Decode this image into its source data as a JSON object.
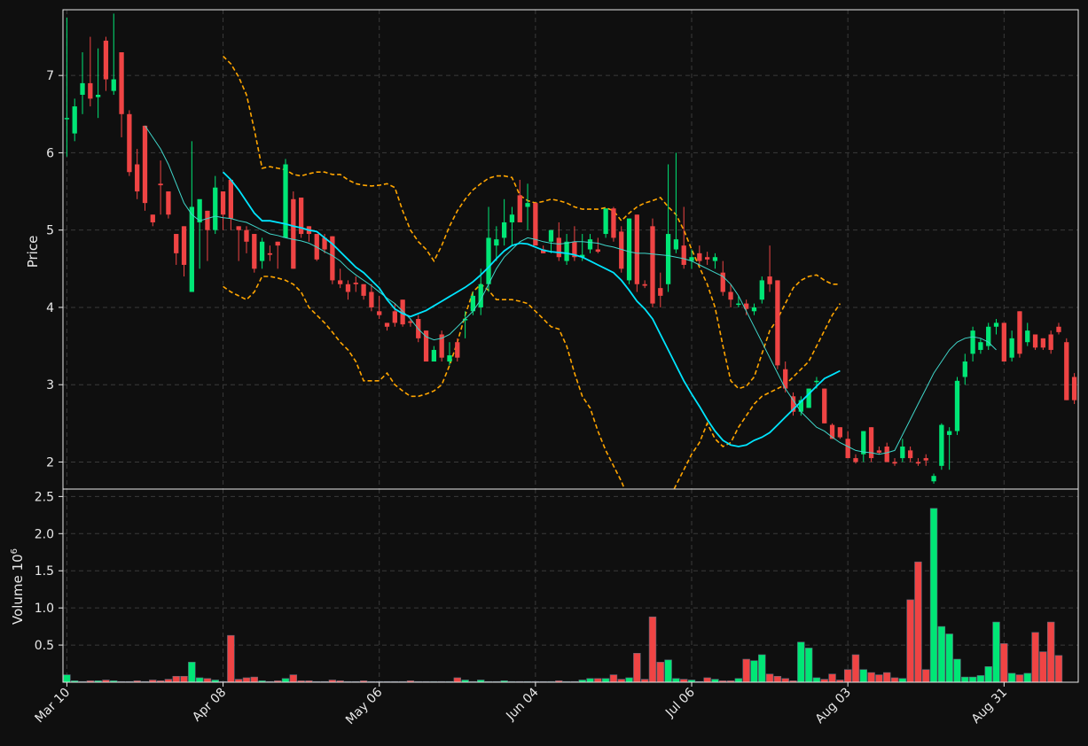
{
  "chart_data": {
    "type": "candlestick",
    "ylabel_price": "Price",
    "ylabel_volume": "Volume",
    "volume_multiplier": "10",
    "volume_exponent": "6",
    "price_ylim": [
      1.65,
      7.85
    ],
    "volume_ylim": [
      0,
      2.6
    ],
    "price_yticks": [
      "2",
      "3",
      "4",
      "5",
      "6",
      "7"
    ],
    "volume_yticks": [
      "0.5",
      "1.0",
      "1.5",
      "2.0",
      "2.5"
    ],
    "date_ticks": [
      {
        "label": "Mar 10",
        "index": 0
      },
      {
        "label": "Apr 08",
        "index": 20
      },
      {
        "label": "May 06",
        "index": 40
      },
      {
        "label": "Jun 04",
        "index": 60
      },
      {
        "label": "Jul 06",
        "index": 80
      },
      {
        "label": "Aug 03",
        "index": 100
      },
      {
        "label": "Aug 31",
        "index": 120
      }
    ],
    "grid": true,
    "colors": {
      "up": "#00e676",
      "down": "#ef4444",
      "ma_fast": "#3fd5c9",
      "ma_slow": "#00e5ff",
      "band": "#ffa500",
      "background": "#0f0f0f"
    },
    "overlays": [
      "moving average (fast)",
      "moving average (slow)",
      "upper band",
      "lower band"
    ],
    "candles": [
      [
        6.45,
        7.75,
        5.95,
        6.45
      ],
      [
        6.25,
        6.7,
        6.15,
        6.6
      ],
      [
        6.75,
        7.3,
        6.5,
        6.9
      ],
      [
        6.9,
        7.5,
        6.6,
        6.7
      ],
      [
        6.72,
        7.35,
        6.45,
        6.75
      ],
      [
        7.45,
        7.5,
        6.8,
        6.95
      ],
      [
        6.8,
        7.8,
        6.75,
        6.95
      ],
      [
        7.3,
        7.3,
        6.2,
        6.5
      ],
      [
        6.5,
        6.55,
        5.7,
        5.75
      ],
      [
        5.85,
        6.05,
        5.4,
        5.5
      ],
      [
        6.35,
        6.35,
        5.25,
        5.35
      ],
      [
        5.2,
        5.2,
        5.05,
        5.1
      ],
      [
        5.6,
        5.9,
        5.2,
        5.58
      ],
      [
        5.5,
        5.5,
        5.15,
        5.2
      ],
      [
        4.95,
        4.95,
        4.55,
        4.7
      ],
      [
        5.05,
        5.05,
        4.4,
        4.55
      ],
      [
        4.2,
        6.15,
        4.2,
        5.3
      ],
      [
        5.1,
        5.35,
        4.5,
        5.4
      ],
      [
        5.25,
        5.25,
        4.6,
        5.0
      ],
      [
        5.0,
        5.7,
        4.95,
        5.55
      ],
      [
        5.5,
        5.5,
        5.0,
        5.2
      ],
      [
        5.65,
        5.65,
        5.0,
        5.15
      ],
      [
        5.05,
        5.05,
        4.6,
        5.0
      ],
      [
        5.0,
        5.05,
        4.7,
        4.85
      ],
      [
        4.95,
        4.95,
        4.45,
        4.5
      ],
      [
        4.6,
        4.9,
        4.5,
        4.85
      ],
      [
        4.7,
        4.8,
        4.6,
        4.68
      ],
      [
        4.85,
        4.85,
        4.5,
        4.8
      ],
      [
        4.9,
        5.92,
        4.9,
        5.85
      ],
      [
        5.4,
        5.5,
        4.5,
        4.5
      ],
      [
        5.42,
        5.42,
        4.9,
        4.95
      ],
      [
        5.05,
        5.05,
        4.85,
        4.95
      ],
      [
        4.95,
        4.95,
        4.6,
        4.62
      ],
      [
        4.9,
        4.95,
        4.7,
        4.75
      ],
      [
        4.92,
        4.92,
        4.3,
        4.35
      ],
      [
        4.35,
        4.5,
        4.25,
        4.3
      ],
      [
        4.3,
        4.35,
        4.1,
        4.2
      ],
      [
        4.32,
        4.4,
        4.2,
        4.3
      ],
      [
        4.3,
        4.3,
        4.1,
        4.15
      ],
      [
        4.2,
        4.3,
        3.95,
        4.0
      ],
      [
        3.95,
        4.15,
        3.85,
        3.9
      ],
      [
        3.8,
        3.8,
        3.7,
        3.75
      ],
      [
        3.95,
        4.05,
        3.75,
        3.8
      ],
      [
        4.1,
        4.1,
        3.75,
        3.78
      ],
      [
        3.82,
        3.85,
        3.75,
        3.8
      ],
      [
        3.85,
        3.9,
        3.55,
        3.6
      ],
      [
        3.7,
        3.7,
        3.3,
        3.3
      ],
      [
        3.3,
        3.5,
        3.3,
        3.45
      ],
      [
        3.65,
        3.7,
        3.3,
        3.35
      ],
      [
        3.3,
        3.55,
        3.25,
        3.38
      ],
      [
        3.55,
        3.6,
        3.3,
        3.35
      ],
      [
        3.85,
        3.95,
        3.6,
        3.85
      ],
      [
        3.95,
        4.2,
        3.9,
        4.15
      ],
      [
        4.0,
        4.5,
        3.9,
        4.3
      ],
      [
        4.3,
        5.3,
        4.2,
        4.9
      ],
      [
        4.8,
        5.05,
        4.6,
        4.88
      ],
      [
        4.9,
        5.4,
        4.8,
        5.1
      ],
      [
        5.1,
        5.3,
        4.8,
        5.2
      ],
      [
        5.45,
        5.65,
        5.4,
        5.1
      ],
      [
        5.3,
        5.6,
        5.0,
        5.35
      ],
      [
        5.35,
        5.35,
        4.85,
        4.8
      ],
      [
        4.75,
        4.8,
        4.7,
        4.7
      ],
      [
        4.85,
        5.0,
        4.7,
        5.0
      ],
      [
        4.9,
        5.1,
        4.6,
        4.65
      ],
      [
        4.6,
        4.95,
        4.55,
        4.85
      ],
      [
        4.85,
        5.05,
        4.6,
        4.65
      ],
      [
        4.65,
        4.95,
        4.6,
        4.68
      ],
      [
        4.75,
        4.95,
        4.7,
        4.88
      ],
      [
        4.75,
        4.9,
        4.7,
        4.72
      ],
      [
        4.95,
        5.2,
        4.9,
        5.28
      ],
      [
        5.28,
        5.3,
        4.85,
        4.9
      ],
      [
        4.98,
        5.05,
        4.45,
        4.5
      ],
      [
        4.35,
        5.15,
        4.3,
        5.15
      ],
      [
        5.2,
        5.2,
        4.2,
        4.3
      ],
      [
        4.3,
        4.35,
        4.25,
        4.28
      ],
      [
        5.05,
        5.15,
        4.0,
        4.05
      ],
      [
        4.25,
        4.45,
        4.0,
        4.15
      ],
      [
        4.3,
        5.85,
        4.2,
        4.95
      ],
      [
        4.75,
        6.0,
        4.7,
        4.88
      ],
      [
        4.8,
        5.3,
        4.5,
        4.55
      ],
      [
        4.6,
        4.75,
        4.5,
        4.65
      ],
      [
        4.7,
        4.8,
        4.55,
        4.6
      ],
      [
        4.65,
        4.72,
        4.55,
        4.62
      ],
      [
        4.6,
        4.7,
        4.5,
        4.65
      ],
      [
        4.45,
        4.6,
        4.15,
        4.2
      ],
      [
        4.2,
        4.3,
        4.0,
        4.1
      ],
      [
        4.05,
        4.15,
        4.0,
        4.05
      ],
      [
        4.05,
        4.1,
        3.9,
        3.98
      ],
      [
        3.95,
        4.05,
        3.9,
        4.0
      ],
      [
        4.1,
        4.4,
        4.05,
        4.35
      ],
      [
        4.4,
        4.8,
        4.2,
        4.3
      ],
      [
        4.35,
        4.35,
        3.2,
        3.25
      ],
      [
        3.2,
        3.3,
        2.9,
        2.95
      ],
      [
        2.85,
        2.9,
        2.6,
        2.65
      ],
      [
        2.65,
        2.85,
        2.6,
        2.8
      ],
      [
        2.7,
        2.95,
        2.7,
        2.95
      ],
      [
        3.05,
        3.1,
        2.95,
        3.05
      ],
      [
        2.95,
        2.95,
        2.5,
        2.5
      ],
      [
        2.48,
        2.5,
        2.3,
        2.3
      ],
      [
        2.45,
        2.45,
        2.3,
        2.32
      ],
      [
        2.3,
        2.4,
        2.05,
        2.05
      ],
      [
        2.05,
        2.1,
        1.98,
        2.0
      ],
      [
        2.1,
        2.4,
        2.0,
        2.4
      ],
      [
        2.45,
        2.45,
        2.0,
        2.05
      ],
      [
        2.15,
        2.2,
        2.1,
        2.12
      ],
      [
        2.2,
        2.25,
        2.0,
        2.0
      ],
      [
        2.0,
        2.05,
        1.95,
        1.98
      ],
      [
        2.05,
        2.3,
        2.0,
        2.2
      ],
      [
        2.15,
        2.2,
        2.0,
        2.05
      ],
      [
        2.0,
        2.05,
        1.95,
        1.98
      ],
      [
        2.05,
        2.1,
        1.95,
        2.02
      ],
      [
        1.75,
        1.85,
        1.72,
        1.82
      ],
      [
        1.95,
        2.5,
        1.9,
        2.48
      ],
      [
        2.35,
        2.45,
        1.9,
        2.4
      ],
      [
        2.4,
        3.1,
        2.35,
        3.05
      ],
      [
        3.1,
        3.4,
        3.0,
        3.3
      ],
      [
        3.4,
        3.75,
        3.3,
        3.7
      ],
      [
        3.45,
        3.6,
        3.4,
        3.55
      ],
      [
        3.5,
        3.8,
        3.45,
        3.75
      ],
      [
        3.75,
        3.85,
        3.65,
        3.8
      ],
      [
        3.8,
        3.8,
        3.3,
        3.3
      ],
      [
        3.35,
        3.7,
        3.3,
        3.6
      ],
      [
        3.95,
        3.95,
        3.35,
        3.4
      ],
      [
        3.55,
        3.8,
        3.5,
        3.7
      ],
      [
        3.65,
        3.65,
        3.45,
        3.48
      ],
      [
        3.6,
        3.6,
        3.45,
        3.48
      ],
      [
        3.65,
        3.7,
        3.4,
        3.45
      ],
      [
        3.75,
        3.8,
        3.65,
        3.68
      ],
      [
        3.55,
        3.6,
        2.8,
        2.8
      ],
      [
        3.1,
        3.15,
        2.75,
        2.8
      ]
    ],
    "volume": [
      0.1,
      0.02,
      0.01,
      0.02,
      0.02,
      0.03,
      0.02,
      0.01,
      0.01,
      0.02,
      0.01,
      0.03,
      0.02,
      0.04,
      0.08,
      0.08,
      0.27,
      0.06,
      0.05,
      0.03,
      0.01,
      0.63,
      0.04,
      0.06,
      0.07,
      0.02,
      0.01,
      0.02,
      0.05,
      0.1,
      0.02,
      0.02,
      0.01,
      0.01,
      0.03,
      0.02,
      0.01,
      0.01,
      0.02,
      0.01,
      0.01,
      0.01,
      0.01,
      0.01,
      0.02,
      0.01,
      0.01,
      0.01,
      0.01,
      0.01,
      0.06,
      0.03,
      0.01,
      0.03,
      0.01,
      0.01,
      0.02,
      0.01,
      0.01,
      0.01,
      0.01,
      0.01,
      0.01,
      0.02,
      0.01,
      0.01,
      0.03,
      0.05,
      0.05,
      0.05,
      0.1,
      0.04,
      0.06,
      0.39,
      0.04,
      0.88,
      0.27,
      0.3,
      0.05,
      0.04,
      0.03,
      0.01,
      0.06,
      0.04,
      0.02,
      0.02,
      0.05,
      0.31,
      0.29,
      0.37,
      0.11,
      0.08,
      0.05,
      0.02,
      0.54,
      0.46,
      0.06,
      0.04,
      0.11,
      0.03,
      0.17,
      0.37,
      0.17,
      0.13,
      0.1,
      0.13,
      0.06,
      0.05,
      1.11,
      1.62,
      0.17,
      2.34,
      0.75,
      0.65,
      0.31,
      0.07,
      0.07,
      0.09,
      0.21,
      0.81,
      0.52,
      0.12,
      0.1,
      0.12,
      0.67,
      0.41,
      0.81,
      0.36
    ],
    "ma_fast": [
      null,
      null,
      null,
      null,
      null,
      null,
      null,
      null,
      null,
      null,
      6.35,
      6.2,
      6.05,
      5.85,
      5.6,
      5.35,
      5.2,
      5.12,
      5.15,
      5.18,
      5.16,
      5.15,
      5.12,
      5.1,
      5.05,
      5.0,
      4.95,
      4.93,
      4.9,
      4.88,
      4.86,
      4.83,
      4.78,
      4.72,
      4.67,
      4.6,
      4.5,
      4.42,
      4.35,
      4.28,
      4.2,
      4.12,
      4.05,
      3.95,
      3.85,
      3.72,
      3.62,
      3.58,
      3.6,
      3.65,
      3.75,
      3.85,
      3.95,
      4.1,
      4.3,
      4.5,
      4.65,
      4.75,
      4.85,
      4.9,
      4.88,
      4.85,
      4.83,
      4.82,
      4.83,
      4.85,
      4.85,
      4.84,
      4.83,
      4.8,
      4.78,
      4.75,
      4.72,
      4.7,
      4.7,
      4.69,
      4.68,
      4.67,
      4.65,
      4.63,
      4.6,
      4.55,
      4.5,
      4.45,
      4.4,
      4.3,
      4.15,
      3.95,
      3.75,
      3.55,
      3.35,
      3.15,
      2.95,
      2.8,
      2.65,
      2.55,
      2.45,
      2.4,
      2.32,
      2.25,
      2.2,
      2.15,
      2.13,
      2.12,
      2.1,
      2.12,
      2.15,
      2.35,
      2.55,
      2.75,
      2.95,
      3.15,
      3.3,
      3.45,
      3.55,
      3.6,
      3.62,
      3.6,
      3.55,
      3.45
    ],
    "ma_slow": [
      null,
      null,
      null,
      null,
      null,
      null,
      null,
      null,
      null,
      null,
      null,
      null,
      null,
      null,
      null,
      null,
      null,
      null,
      null,
      null,
      5.75,
      5.65,
      5.52,
      5.37,
      5.22,
      5.12,
      5.12,
      5.1,
      5.08,
      5.05,
      5.03,
      5.0,
      4.98,
      4.9,
      4.82,
      4.72,
      4.62,
      4.52,
      4.45,
      4.35,
      4.25,
      4.1,
      3.98,
      3.92,
      3.88,
      3.92,
      3.96,
      4.02,
      4.08,
      4.14,
      4.2,
      4.26,
      4.33,
      4.42,
      4.52,
      4.63,
      4.73,
      4.8,
      4.83,
      4.82,
      4.78,
      4.74,
      4.72,
      4.71,
      4.7,
      4.68,
      4.65,
      4.6,
      4.55,
      4.5,
      4.45,
      4.35,
      4.22,
      4.08,
      3.98,
      3.85,
      3.65,
      3.45,
      3.25,
      3.05,
      2.88,
      2.72,
      2.55,
      2.4,
      2.28,
      2.22,
      2.2,
      2.22,
      2.28,
      2.32,
      2.38,
      2.48,
      2.58,
      2.68,
      2.78,
      2.88,
      2.98,
      3.08,
      3.13,
      3.18
    ],
    "band_upper": [
      null,
      null,
      null,
      null,
      null,
      null,
      null,
      null,
      null,
      null,
      null,
      null,
      null,
      null,
      null,
      null,
      null,
      null,
      null,
      null,
      7.25,
      7.15,
      6.98,
      6.75,
      6.3,
      5.8,
      5.82,
      5.8,
      5.78,
      5.72,
      5.7,
      5.73,
      5.75,
      5.75,
      5.72,
      5.72,
      5.65,
      5.6,
      5.58,
      5.57,
      5.58,
      5.6,
      5.55,
      5.25,
      5.0,
      4.85,
      4.75,
      4.6,
      4.8,
      5.05,
      5.25,
      5.4,
      5.52,
      5.6,
      5.67,
      5.7,
      5.7,
      5.68,
      5.45,
      5.38,
      5.35,
      5.37,
      5.4,
      5.38,
      5.35,
      5.3,
      5.27,
      5.27,
      5.27,
      5.29,
      5.25,
      5.12,
      5.22,
      5.3,
      5.35,
      5.38,
      5.42,
      5.3,
      5.2,
      5.0,
      4.75,
      4.52,
      4.3,
      4.0,
      3.5,
      3.05,
      2.95,
      2.98,
      3.1,
      3.4,
      3.7,
      3.85,
      4.05,
      4.25,
      4.35,
      4.4,
      4.42,
      4.35,
      4.3,
      4.3
    ],
    "band_lower": [
      null,
      null,
      null,
      null,
      null,
      null,
      null,
      null,
      null,
      null,
      null,
      null,
      null,
      null,
      null,
      null,
      null,
      null,
      null,
      null,
      4.27,
      4.2,
      4.15,
      4.1,
      4.2,
      4.4,
      4.4,
      4.38,
      4.35,
      4.3,
      4.2,
      4.0,
      3.9,
      3.8,
      3.68,
      3.55,
      3.45,
      3.3,
      3.05,
      3.05,
      3.05,
      3.15,
      3.0,
      2.92,
      2.85,
      2.85,
      2.88,
      2.92,
      3.0,
      3.25,
      3.55,
      3.9,
      4.2,
      4.3,
      4.22,
      4.1,
      4.1,
      4.1,
      4.08,
      4.05,
      3.95,
      3.85,
      3.75,
      3.72,
      3.5,
      3.15,
      2.85,
      2.7,
      2.4,
      2.15,
      1.95,
      1.75,
      1.5,
      1.3,
      1.2,
      1.18,
      1.25,
      1.5,
      1.7,
      1.9,
      2.1,
      2.25,
      2.5,
      2.3,
      2.2,
      2.25,
      2.45,
      2.6,
      2.75,
      2.85,
      2.9,
      2.95,
      3.0,
      3.1,
      3.2,
      3.3,
      3.5,
      3.7,
      3.9,
      4.05
    ]
  }
}
